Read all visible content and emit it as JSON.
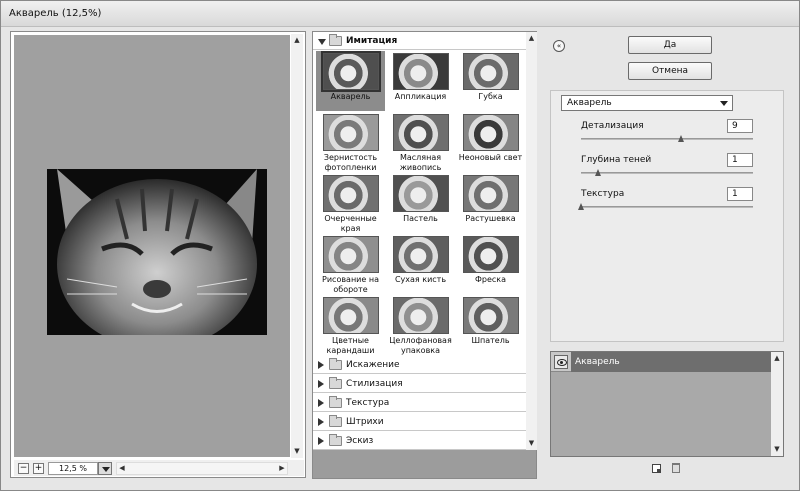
{
  "window": {
    "title": "Акварель (12,5%)"
  },
  "preview": {
    "zoom": "12,5 %",
    "zoom_out": "−",
    "zoom_in": "+"
  },
  "gallery": {
    "open_category": "Имитация",
    "filters": [
      [
        "Акварель"
      ],
      [
        "Аппликация"
      ],
      [
        "Губка"
      ],
      [
        "Зернистость",
        "фотопленки"
      ],
      [
        "Масляная",
        "живопись"
      ],
      [
        "Неоновый свет"
      ],
      [
        "Очерченные края"
      ],
      [
        "Пастель"
      ],
      [
        "Растушевка"
      ],
      [
        "Рисование на",
        "обороте"
      ],
      [
        "Сухая кисть"
      ],
      [
        "Фреска"
      ],
      [
        "Цветные",
        "карандаши"
      ],
      [
        "Целлофановая",
        "упаковка"
      ],
      [
        "Шпатель"
      ]
    ],
    "selected_filter": "Акварель",
    "other_categories": [
      "Искажение",
      "Стилизация",
      "Текстура",
      "Штрихи",
      "Эскиз"
    ]
  },
  "buttons": {
    "ok": "Да",
    "cancel": "Отмена"
  },
  "settings": {
    "selected_filter": "Акварель",
    "params": [
      {
        "label": "Детализация",
        "value": "9",
        "fraction": 0.6
      },
      {
        "label": "Глубина теней",
        "value": "1",
        "fraction": 0.1
      },
      {
        "label": "Текстура",
        "value": "1",
        "fraction": 0.0
      }
    ]
  },
  "layers": {
    "items": [
      "Акварель"
    ]
  }
}
